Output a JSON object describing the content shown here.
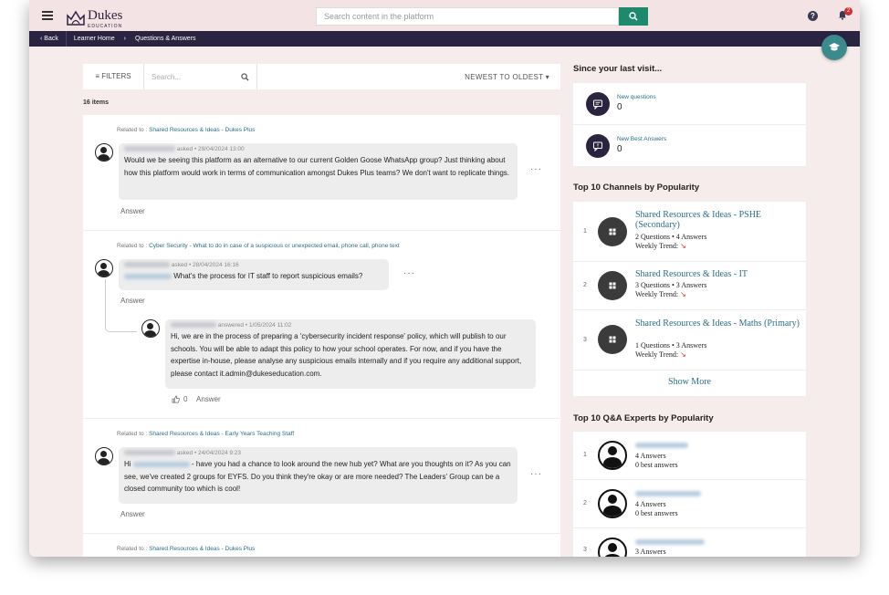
{
  "header": {
    "brand": "Dukes",
    "brand_sub": "EDUCATION",
    "search_placeholder": "Search content in the platform",
    "help_label": "?",
    "notification_count": "2"
  },
  "nav": {
    "back_label": "Back",
    "crumb_home": "Learner Home",
    "crumb_current": "Questions & Answers"
  },
  "toolbar": {
    "filters_label": "FILTERS",
    "search_placeholder": "Search...",
    "sort_label": "NEWEST TO OLDEST"
  },
  "feed": {
    "item_count": "16 items",
    "posts": [
      {
        "related_prefix": "Related to :",
        "channel": "Shared Resources & Ideas - Dukes Plus",
        "meta": "asked • 29/04/2024 13:00",
        "text": "Would we be seeing this platform as an alternative to our current Golden Goose WhatsApp group?  Just thinking about how this platform would work in terms of communication amongst Dukes Plus teams?  We don't want to replicate things.",
        "answer_label": "Answer"
      },
      {
        "related_prefix": "Related to :",
        "channel": "Cyber Security - What to do in case of a suspicious or unexpected email, phone call, phone text",
        "meta": "asked • 28/04/2024 16:16",
        "text": "What's the process for IT staff to report suspicious emails?",
        "answer_label": "Answer",
        "reply": {
          "meta": "answered • 1/05/2024 11:02",
          "text": "Hi, we are in the process of preparing a 'cybersecurity incident response' policy, which will publish to our schools. You will be able to adapt this policy to how your school operates. For now, and if you have the expertise in-house, please analyse any suspicious emails internally and if you require any additional support, please contact it.admin@dukeseducation.com.",
          "likes": "0",
          "answer_label": "Answer"
        }
      },
      {
        "related_prefix": "Related to :",
        "channel": "Shared Resources & Ideas - Early Years Teaching Staff",
        "meta": "asked • 24/04/2024 9:23",
        "text_start": "Hi",
        "text": "- have you had a chance to look around the new hub yet? What are you thoughts on it? As you can see, we've created 2 groups for EYFS. Do you think they're okay or are more needed? The Leaders' Group can be a closed community too which is cool!",
        "answer_label": "Answer"
      },
      {
        "related_prefix": "Related to :",
        "channel": "Shared Resources & Ideas - Dukes Plus"
      }
    ]
  },
  "since_visit": {
    "title": "Since your last visit...",
    "items": [
      {
        "label": "New questions",
        "value": "0",
        "icon": "new-question-icon"
      },
      {
        "label": "New Best Answers",
        "value": "0",
        "icon": "best-answer-icon"
      }
    ]
  },
  "channels": {
    "title": "Top 10 Channels by Popularity",
    "items": [
      {
        "rank": "1",
        "name": "Shared Resources & Ideas - PSHE (Secondary)",
        "stats": "2 Questions • 4 Answers",
        "trend": "Weekly Trend:"
      },
      {
        "rank": "2",
        "name": "Shared Resources & Ideas - IT",
        "stats": "3 Questions • 3 Answers",
        "trend": "Weekly Trend:"
      },
      {
        "rank": "3",
        "name": "Shared Resources & Ideas - Maths (Primary)",
        "stats": "1 Questions • 3 Answers",
        "trend": "Weekly Trend:"
      }
    ],
    "show_more": "Show More"
  },
  "experts": {
    "title": "Top 10 Q&A Experts by Popularity",
    "items": [
      {
        "rank": "1",
        "answers": "4 Answers",
        "best": "0 best answers"
      },
      {
        "rank": "2",
        "answers": "4 Answers",
        "best": "0 best answers"
      },
      {
        "rank": "3",
        "answers": "3 Answers",
        "best": ""
      }
    ]
  },
  "colors": {
    "accent": "#1d8a6e",
    "nav_bg": "#2b2440",
    "link": "#2a6f8a",
    "trend_down": "#d32f2f"
  }
}
